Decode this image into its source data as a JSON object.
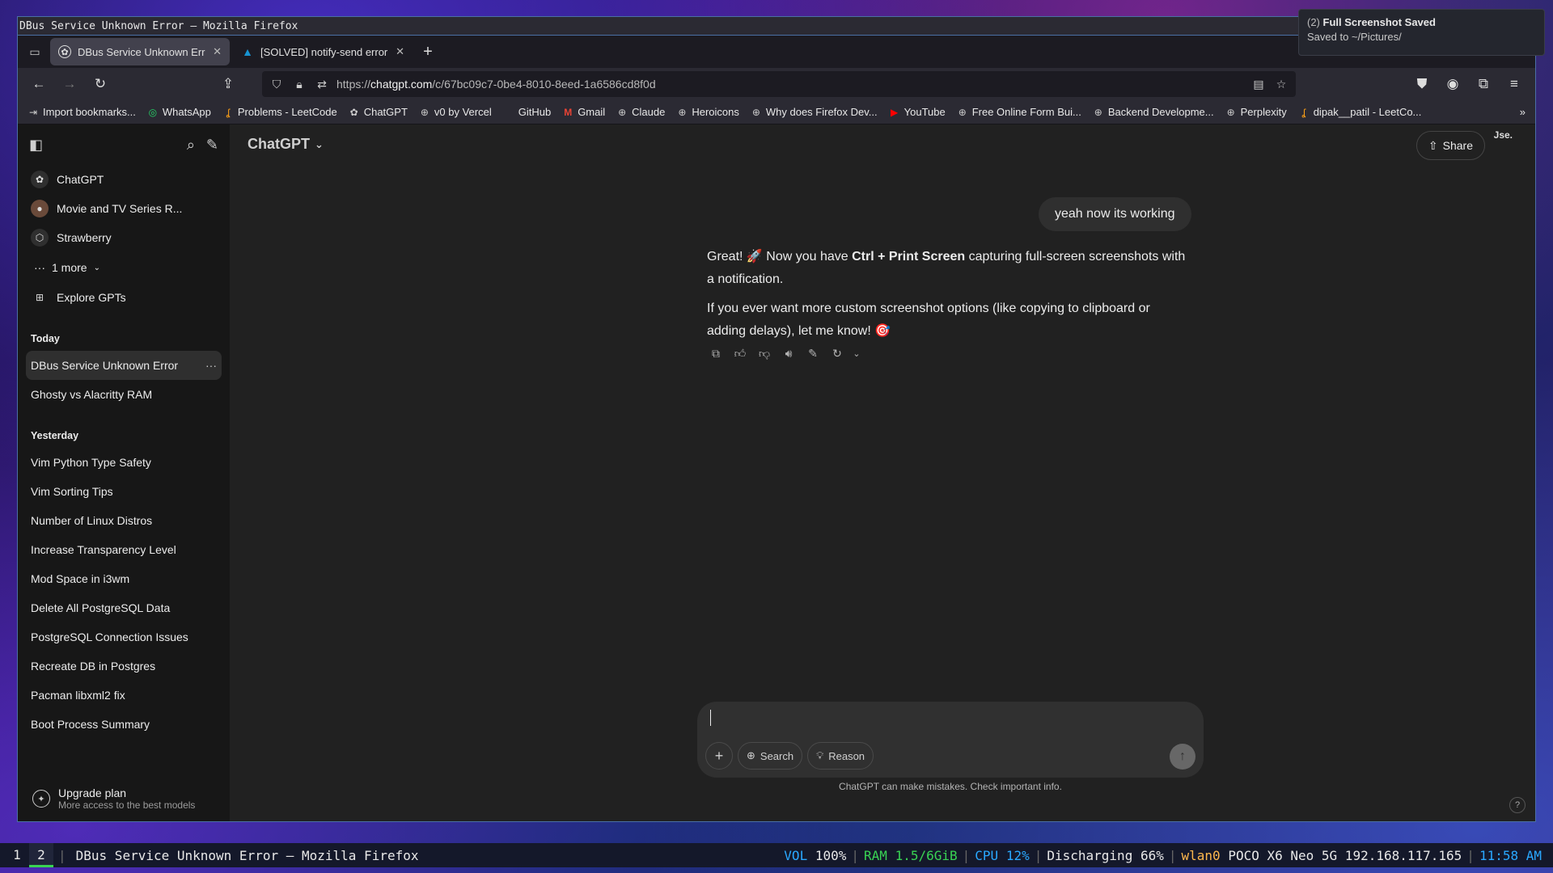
{
  "window": {
    "title": "DBus Service Unknown Error — Mozilla Firefox"
  },
  "tabs": [
    {
      "label": "DBus Service Unknown Err",
      "favicon": "chatgpt-icon",
      "active": true
    },
    {
      "label": "[SOLVED] notify-send error",
      "favicon": "arch-icon",
      "active": false
    }
  ],
  "navbar": {
    "url_prefix": "https://",
    "url_host": "chatgpt.com",
    "url_path": "/c/67bc09c7-0be4-8010-8eed-1a6586cd8f0d"
  },
  "bookmarks": [
    {
      "label": "Import bookmarks...",
      "icon": "import-icon"
    },
    {
      "label": "WhatsApp",
      "icon": "whatsapp-icon"
    },
    {
      "label": "Problems - LeetCode",
      "icon": "leetcode-icon"
    },
    {
      "label": "ChatGPT",
      "icon": "chatgpt-icon"
    },
    {
      "label": "v0 by Vercel",
      "icon": "globe-icon"
    },
    {
      "label": "GitHub",
      "icon": "github-icon"
    },
    {
      "label": "Gmail",
      "icon": "gmail-icon"
    },
    {
      "label": "Claude",
      "icon": "globe-icon"
    },
    {
      "label": "Heroicons",
      "icon": "globe-icon"
    },
    {
      "label": "Why does Firefox Dev...",
      "icon": "globe-icon"
    },
    {
      "label": "YouTube",
      "icon": "youtube-icon"
    },
    {
      "label": "Free Online Form Bui...",
      "icon": "globe-icon"
    },
    {
      "label": "Backend Developme...",
      "icon": "globe-icon"
    },
    {
      "label": "Perplexity",
      "icon": "globe-icon"
    },
    {
      "label": "dipak__patil - LeetCo...",
      "icon": "leetcode-icon"
    }
  ],
  "sidebar": {
    "gpts": [
      {
        "label": "ChatGPT"
      },
      {
        "label": "Movie and TV Series R..."
      },
      {
        "label": "Strawberry"
      }
    ],
    "more_label": "1 more",
    "explore_label": "Explore GPTs",
    "today_label": "Today",
    "today": [
      {
        "label": "DBus Service Unknown Error",
        "active": true
      },
      {
        "label": "Ghosty vs Alacritty RAM",
        "active": false
      }
    ],
    "yesterday_label": "Yesterday",
    "yesterday": [
      {
        "label": "Vim Python Type Safety"
      },
      {
        "label": "Vim Sorting Tips"
      },
      {
        "label": "Number of Linux Distros"
      },
      {
        "label": "Increase Transparency Level"
      },
      {
        "label": "Mod Space in i3wm"
      },
      {
        "label": "Delete All PostgreSQL Data"
      },
      {
        "label": "PostgreSQL Connection Issues"
      },
      {
        "label": "Recreate DB in Postgres"
      },
      {
        "label": "Pacman libxml2 fix"
      },
      {
        "label": "Boot Process Summary"
      }
    ],
    "upgrade_title": "Upgrade plan",
    "upgrade_sub": "More access to the best models"
  },
  "main": {
    "model_label": "ChatGPT",
    "share_label": "Share",
    "corner_text": "Jse.",
    "user_message": "yeah now its working",
    "assistant": {
      "p1_a": "Great! 🚀 Now you have ",
      "p1_bold": "Ctrl + Print Screen",
      "p1_b": " capturing full-screen screenshots with a notification.",
      "p2": "If you ever want more custom screenshot options (like copying to clipboard or adding delays), let me know! 🎯"
    },
    "composer": {
      "search_label": "Search",
      "reason_label": "Reason"
    },
    "disclaimer": "ChatGPT can make mistakes. Check important info.",
    "help": "?"
  },
  "notification": {
    "count": "(2)",
    "title": "Full Screenshot Saved",
    "body": "Saved to ~/Pictures/"
  },
  "statusbar": {
    "workspaces": [
      "1",
      "2"
    ],
    "active_workspace": "2",
    "title": "DBus Service Unknown Error — Mozilla Firefox",
    "vol_label": "VOL",
    "vol_value": "100%",
    "ram_label": "RAM",
    "ram_value": "1.5/6GiB",
    "cpu_label": "CPU",
    "cpu_value": "12%",
    "battery": "Discharging 66%",
    "wlan_label": "wlan0",
    "wlan_value": "POCO X6 Neo 5G 192.168.117.165",
    "time": "11:58 AM"
  },
  "colors": {
    "accent": "#2aa8ff",
    "workspace_active": "#39d353",
    "ram": "#39d353",
    "wlan": "#ffb84d"
  }
}
